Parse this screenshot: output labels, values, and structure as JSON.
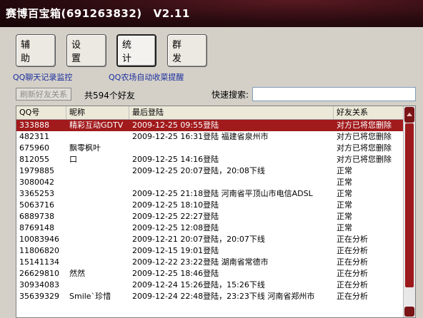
{
  "window": {
    "title": "赛博百宝箱(691263832)",
    "version": "V2.11"
  },
  "toolbar": [
    {
      "label": "辅 助",
      "active": false
    },
    {
      "label": "设 置",
      "active": false
    },
    {
      "label": "统 计",
      "active": true
    },
    {
      "label": "群 发",
      "active": false
    }
  ],
  "links": {
    "chat_monitor": "QQ聊天记录监控",
    "farm_harvest": "QQ农场自动收菜提醒"
  },
  "controls": {
    "refresh_label": "刷新好友关系",
    "friend_count": "共594个好友",
    "search_label": "快速搜索:",
    "search_value": ""
  },
  "table": {
    "columns": [
      "QQ号",
      "昵称",
      "最后登陆",
      "好友关系"
    ],
    "rows": [
      {
        "qq": "333888",
        "nick": "精彩互动GDTV",
        "login": "2009-12-25 09:55登陆",
        "relation": "对方已将您删除",
        "selected": true
      },
      {
        "qq": "482311",
        "nick": "",
        "login": "2009-12-25 16:31登陆 福建省泉州市",
        "relation": "对方已将您删除"
      },
      {
        "qq": "675960",
        "nick": "飘零枫叶",
        "login": "",
        "relation": "对方已将您删除"
      },
      {
        "qq": "812055",
        "nick": "口",
        "login": "2009-12-25 14:16登陆",
        "relation": "对方已将您删除"
      },
      {
        "qq": "1979885",
        "nick": "",
        "login": "2009-12-25 20:07登陆，20:08下线",
        "relation": "正常"
      },
      {
        "qq": "3080042",
        "nick": "",
        "login": "",
        "relation": "正常"
      },
      {
        "qq": "3365253",
        "nick": "",
        "login": "2009-12-25 21:18登陆 河南省平顶山市电信ADSL",
        "relation": "正常"
      },
      {
        "qq": "5063716",
        "nick": "",
        "login": "2009-12-25 18:10登陆",
        "relation": "正常"
      },
      {
        "qq": "6889738",
        "nick": "",
        "login": "2009-12-25 22:27登陆",
        "relation": "正常"
      },
      {
        "qq": "8769148",
        "nick": "",
        "login": "2009-12-25 12:08登陆",
        "relation": "正常"
      },
      {
        "qq": "10083946",
        "nick": "",
        "login": "2009-12-21 20:07登陆，20:07下线",
        "relation": "正在分析"
      },
      {
        "qq": "11806820",
        "nick": "",
        "login": "2009-12-15 19:01登陆",
        "relation": "正在分析"
      },
      {
        "qq": "15141134",
        "nick": "",
        "login": "2009-12-22 23:22登陆 湖南省常德市",
        "relation": "正在分析"
      },
      {
        "qq": "26629810",
        "nick": "然然",
        "login": "2009-12-25 18:46登陆",
        "relation": "正在分析"
      },
      {
        "qq": "30934083",
        "nick": "",
        "login": "2009-12-24 15:26登陆，15:26下线",
        "relation": "正在分析"
      },
      {
        "qq": "35639329",
        "nick": "Smile`珍惜",
        "login": "2009-12-24 22:48登陆，23:23下线 河南省郑州市",
        "relation": "正在分析"
      }
    ]
  }
}
